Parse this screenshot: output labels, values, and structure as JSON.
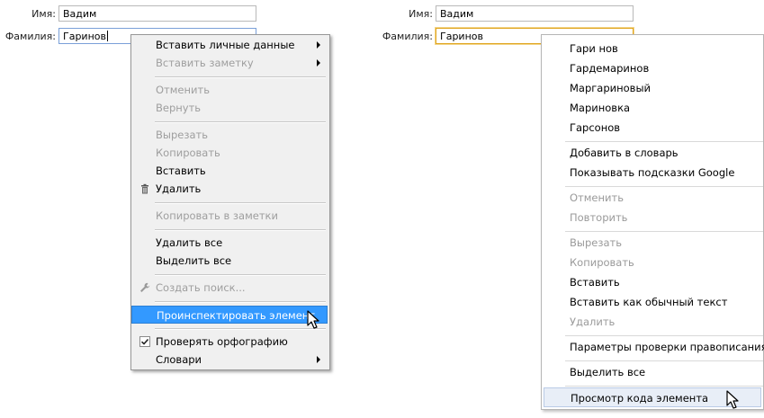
{
  "left_form": {
    "first_name_label": "Имя:",
    "first_name_value": "Вадим",
    "last_name_label": "Фамилия:",
    "last_name_value": "Гаринов"
  },
  "right_form": {
    "first_name_label": "Имя:",
    "first_name_value": "Вадим",
    "last_name_label": "Фамилия:",
    "last_name_value": "Гаринов"
  },
  "menu_firefox": {
    "insert_personal": "Вставить личные данные",
    "insert_note": "Вставить заметку",
    "undo": "Отменить",
    "redo": "Вернуть",
    "cut": "Вырезать",
    "copy": "Копировать",
    "paste": "Вставить",
    "delete": "Удалить",
    "copy_to_notes": "Копировать в заметки",
    "delete_all": "Удалить все",
    "select_all": "Выделить все",
    "create_search": "Создать поиск...",
    "inspect": "Проинспектировать элемент",
    "check_spelling": "Проверять орфографию",
    "dictionaries": "Словари"
  },
  "menu_chrome": {
    "suggestions": [
      "Гари нов",
      "Гардемаринов",
      "Маргариновый",
      "Мариновка",
      "Гарсонов"
    ],
    "add_to_dictionary": "Добавить в словарь",
    "google_hints": "Показывать подсказки Google",
    "undo": "Отменить",
    "redo": "Повторить",
    "cut": "Вырезать",
    "copy": "Копировать",
    "paste": "Вставить",
    "paste_plain": "Вставить как обычный текст",
    "delete": "Удалить",
    "spell_settings": "Параметры проверки правописания",
    "select_all": "Выделить все",
    "view_source": "Просмотр кода элемента"
  },
  "colors": {
    "highlight_blue": "#3399ff",
    "chrome_highlight": "#e8eef7",
    "focus_gold": "#e0a520"
  },
  "icons": {
    "trash": "trash-icon",
    "wrench": "wrench-icon",
    "checkbox": "checkbox-checked-icon",
    "submenu": "submenu-arrow-icon",
    "cursor": "mouse-pointer-icon"
  }
}
